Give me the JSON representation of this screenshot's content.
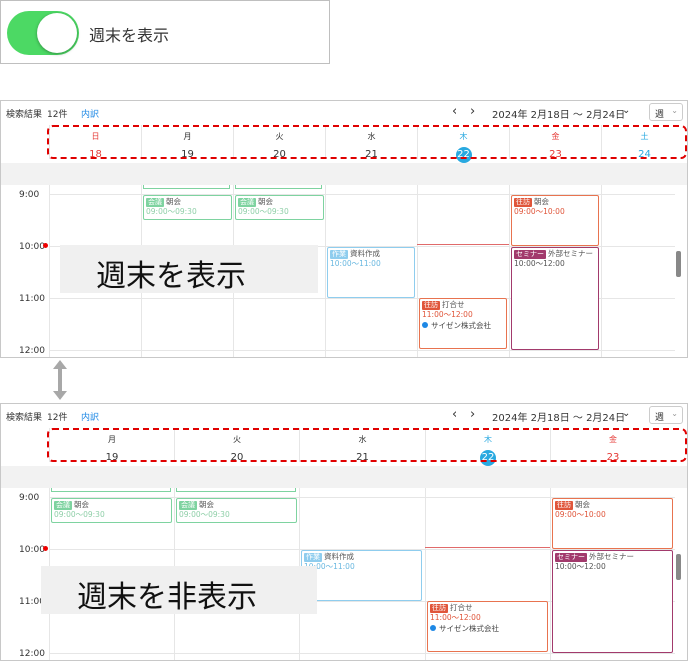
{
  "toggle": {
    "label": "週末を表示",
    "on": true,
    "accent": "#4cd964"
  },
  "panels": [
    {
      "toolbar": {
        "search_label": "検索結果",
        "count": "12件",
        "breakdown_link": "内訳",
        "prev": "‹",
        "next": "›",
        "date_range": "2024年 2月18日 〜 2月24日",
        "view": "週"
      },
      "days": [
        {
          "name": "日",
          "date": "18",
          "color": "#e53935",
          "today": false
        },
        {
          "name": "月",
          "date": "19",
          "color": "#333333",
          "today": false
        },
        {
          "name": "火",
          "date": "20",
          "color": "#333333",
          "today": false
        },
        {
          "name": "水",
          "date": "21",
          "color": "#333333",
          "today": false
        },
        {
          "name": "木",
          "date": "22",
          "color": "#29a9e0",
          "today": true
        },
        {
          "name": "金",
          "date": "23",
          "color": "#e53935",
          "today": false
        },
        {
          "name": "土",
          "date": "24",
          "color": "#29a9e0",
          "today": false
        }
      ],
      "times": [
        "9:00",
        "10:00",
        "11:00",
        "12:00"
      ],
      "events": {
        "mon_meeting": {
          "tag": "会議",
          "title": "朝会",
          "time": "09:00〜09:30"
        },
        "tue_meeting": {
          "tag": "会議",
          "title": "朝会",
          "time": "09:00〜09:30"
        },
        "wed_work": {
          "tag": "作業",
          "title": "資料作成",
          "time": "10:00〜11:00"
        },
        "thu_visit": {
          "tag": "往訪",
          "title": "打合せ",
          "time": "11:00〜12:00",
          "location": "サイゼン株式会社"
        },
        "fri_visit": {
          "tag": "往訪",
          "title": "朝会",
          "time": "09:00〜10:00"
        },
        "fri_seminar": {
          "tag": "セミナー",
          "title": "外部セミナー",
          "time": "10:00〜12:00"
        }
      },
      "overlay": "週末を表示"
    },
    {
      "toolbar": {
        "search_label": "検索結果",
        "count": "12件",
        "breakdown_link": "内訳",
        "prev": "‹",
        "next": "›",
        "date_range": "2024年 2月18日 〜 2月24日",
        "view": "週"
      },
      "days": [
        {
          "name": "月",
          "date": "19",
          "color": "#333333",
          "today": false
        },
        {
          "name": "火",
          "date": "20",
          "color": "#333333",
          "today": false
        },
        {
          "name": "水",
          "date": "21",
          "color": "#333333",
          "today": false
        },
        {
          "name": "木",
          "date": "22",
          "color": "#29a9e0",
          "today": true
        },
        {
          "name": "金",
          "date": "23",
          "color": "#e53935",
          "today": false
        }
      ],
      "times": [
        "9:00",
        "10:00",
        "11:00",
        "12:00"
      ],
      "events": {
        "mon_meeting": {
          "tag": "会議",
          "title": "朝会",
          "time": "09:00〜09:30"
        },
        "tue_meeting": {
          "tag": "会議",
          "title": "朝会",
          "time": "09:00〜09:30"
        },
        "wed_work": {
          "tag": "作業",
          "title": "資料作成",
          "time": "10:00〜11:00"
        },
        "thu_visit": {
          "tag": "往訪",
          "title": "打合せ",
          "time": "11:00〜12:00",
          "location": "サイゼン株式会社"
        },
        "fri_visit": {
          "tag": "往訪",
          "title": "朝会",
          "time": "09:00〜10:00"
        },
        "fri_seminar": {
          "tag": "セミナー",
          "title": "外部セミナー",
          "time": "10:00〜12:00"
        }
      },
      "overlay": "週末を非表示"
    }
  ]
}
